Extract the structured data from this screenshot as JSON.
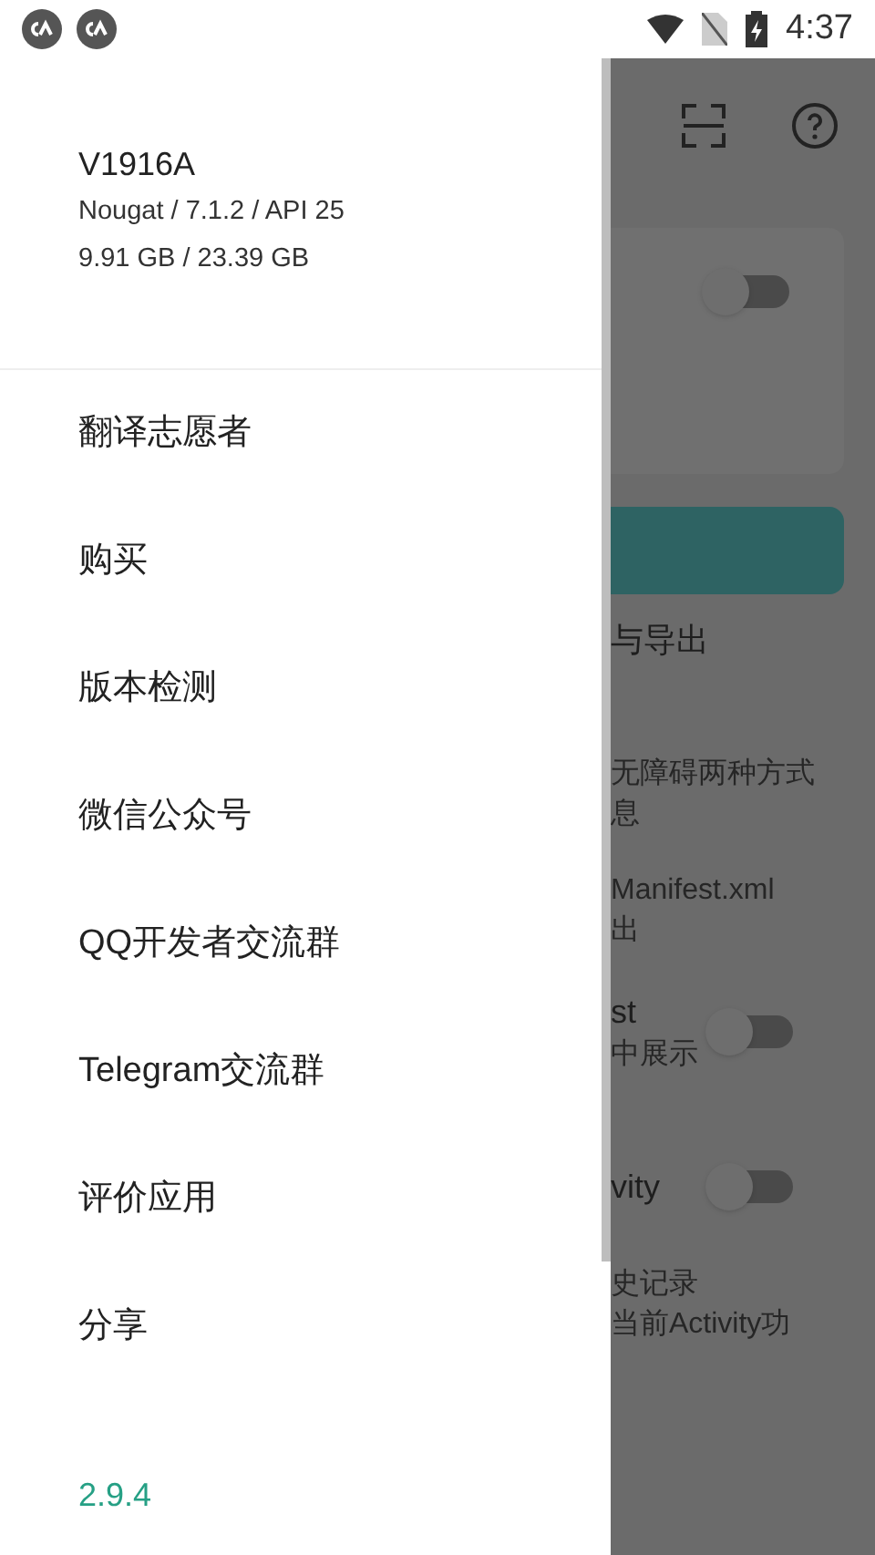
{
  "status_bar": {
    "time": "4:37"
  },
  "background": {
    "card": {
      "switch_on": false
    },
    "rows": [
      {
        "title": "与导出",
        "subtitle": ""
      },
      {
        "title": "",
        "subtitle": "无障碍两种方式"
      },
      {
        "title": "",
        "subtitle": "息"
      },
      {
        "title": "",
        "subtitle": "Manifest.xml"
      },
      {
        "title": "",
        "subtitle": "出"
      },
      {
        "title": "st",
        "subtitle": "中展示",
        "switch_on": false
      },
      {
        "title": "vity",
        "subtitle": "",
        "switch_on": false
      },
      {
        "title": "",
        "subtitle": "史记录"
      },
      {
        "title": "",
        "subtitle": "当前Activity功"
      }
    ]
  },
  "drawer": {
    "model": "V1916A",
    "system": "Nougat / 7.1.2 / API 25",
    "storage": "9.91 GB / 23.39 GB",
    "items": [
      {
        "label": "翻译志愿者"
      },
      {
        "label": "购买"
      },
      {
        "label": "版本检测"
      },
      {
        "label": "微信公众号"
      },
      {
        "label": "QQ开发者交流群"
      },
      {
        "label": "Telegram交流群"
      },
      {
        "label": "评价应用"
      },
      {
        "label": "分享"
      }
    ],
    "version": "2.9.4"
  }
}
